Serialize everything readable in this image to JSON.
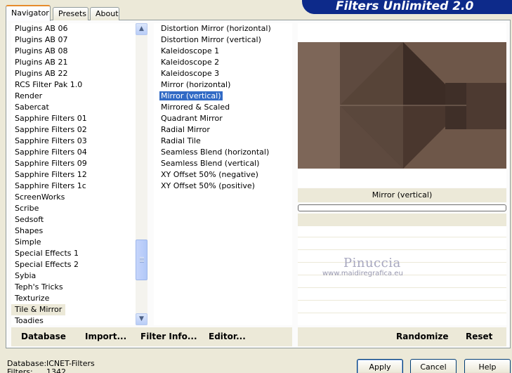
{
  "banner": {
    "title": "Filters Unlimited 2.0"
  },
  "tabs": [
    {
      "label": "Navigator",
      "active": true
    },
    {
      "label": "Presets",
      "active": false
    },
    {
      "label": "About",
      "active": false
    }
  ],
  "categories": [
    "Plugins AB 06",
    "Plugins AB 07",
    "Plugins AB 08",
    "Plugins AB 21",
    "Plugins AB 22",
    "RCS Filter Pak 1.0",
    "Render",
    "Sabercat",
    "Sapphire Filters 01",
    "Sapphire Filters 02",
    "Sapphire Filters 03",
    "Sapphire Filters 04",
    "Sapphire Filters 09",
    "Sapphire Filters 12",
    "Sapphire Filters 1c",
    "ScreenWorks",
    "Scribe",
    "Sedsoft",
    "Shapes",
    "Simple",
    "Special Effects 1",
    "Special Effects 2",
    "Sybia",
    "Teph's Tricks",
    "Texturize",
    "Tile & Mirror",
    "Toadies"
  ],
  "selected_category": "Tile & Mirror",
  "filters": [
    "Distortion Mirror (horizontal)",
    "Distortion Mirror (vertical)",
    "Kaleidoscope 1",
    "Kaleidoscope 2",
    "Kaleidoscope 3",
    "Mirror (horizontal)",
    "Mirror (vertical)",
    "Mirrored & Scaled",
    "Quadrant Mirror",
    "Radial Mirror",
    "Radial Tile",
    "Seamless Blend (horizontal)",
    "Seamless Blend (vertical)",
    "XY Offset 50% (negative)",
    "XY Offset 50% (positive)"
  ],
  "selected_filter": "Mirror (vertical)",
  "preview": {
    "filter_name": "Mirror (vertical)"
  },
  "watermark": {
    "name": "Pinuccia",
    "url": "www.maidiregrafica.eu"
  },
  "footer_buttons": {
    "database": "Database",
    "import": "Import...",
    "filter_info": "Filter Info...",
    "editor": "Editor...",
    "randomize": "Randomize",
    "reset": "Reset"
  },
  "info": {
    "database_label": "Database:",
    "database_value": "ICNET-Filters",
    "filters_label": "Filters:",
    "filters_value": "1342"
  },
  "dialog_buttons": {
    "apply": "Apply",
    "cancel": "Cancel",
    "help": "Help"
  },
  "colors": {
    "selection": "#316ac5",
    "banner": "#0d2a8a",
    "active_tab_accent": "#e68b2c"
  }
}
